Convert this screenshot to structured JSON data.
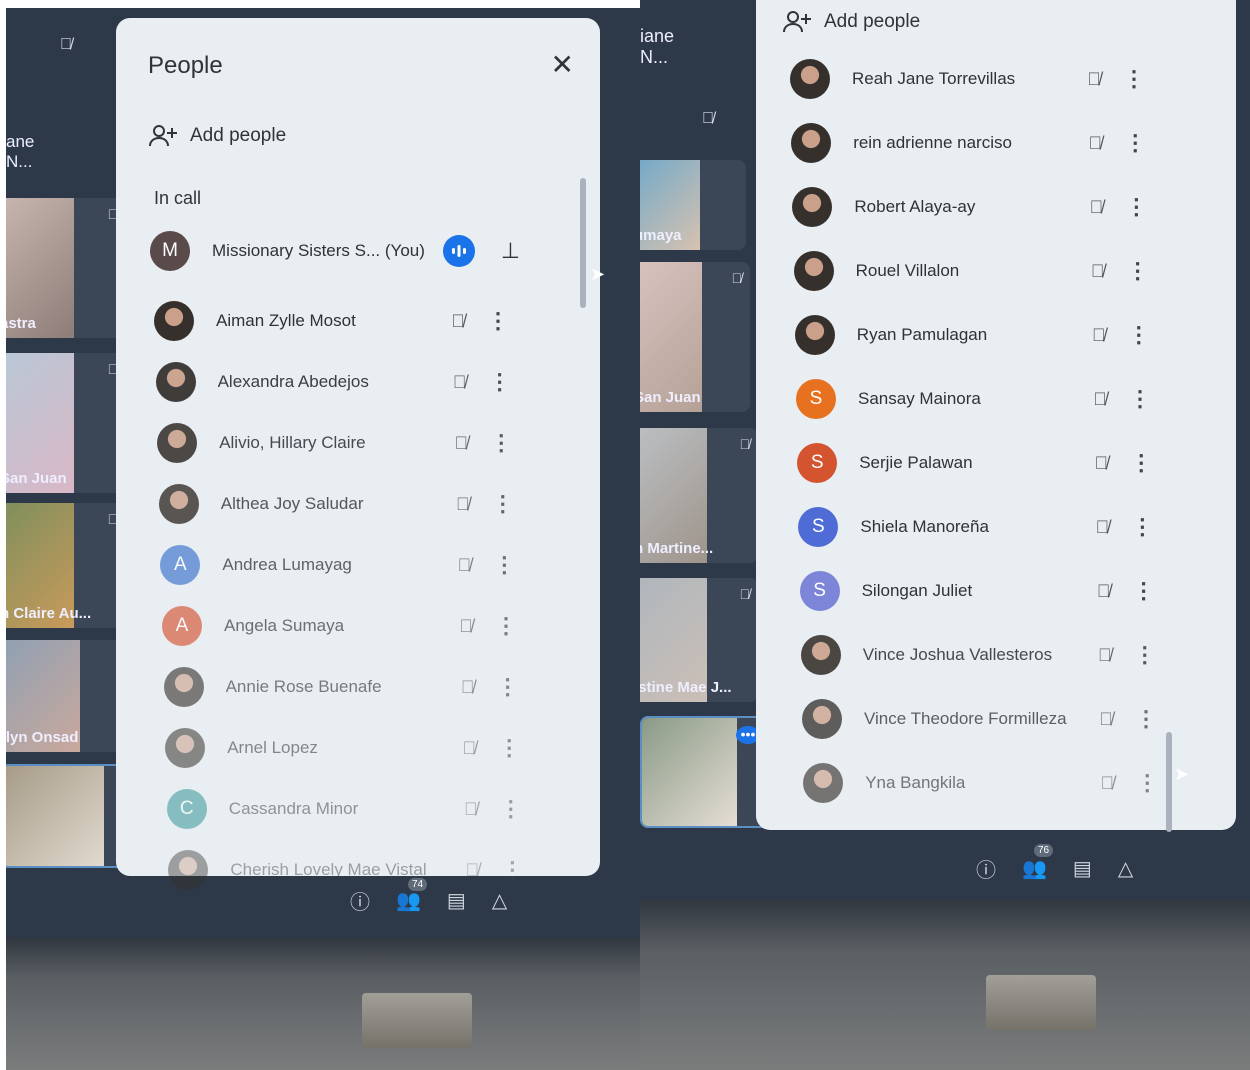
{
  "left": {
    "panel_title": "People",
    "add_people_label": "Add people",
    "section_label": "In call",
    "self": {
      "initial": "M",
      "name": "Missionary Sisters S...",
      "you_tag": "(You)"
    },
    "participants": [
      {
        "name": "Aiman Zylle Mosot",
        "initial": "",
        "color": ""
      },
      {
        "name": "Alexandra Abedejos",
        "initial": "",
        "color": ""
      },
      {
        "name": "Alivio, Hillary Claire",
        "initial": "",
        "color": ""
      },
      {
        "name": "Althea Joy Saludar",
        "initial": "",
        "color": ""
      },
      {
        "name": "Andrea Lumayag",
        "initial": "A",
        "color": "#4f7fd1"
      },
      {
        "name": "Angela Sumaya",
        "initial": "A",
        "color": "#d55a3a"
      },
      {
        "name": "Annie Rose Buenafe",
        "initial": "",
        "color": ""
      },
      {
        "name": "Arnel Lopez",
        "initial": "",
        "color": ""
      },
      {
        "name": "Cassandra Minor",
        "initial": "C",
        "color": "#1b8a8d"
      },
      {
        "name": "Cherish Lovely Mae Vistal",
        "initial": "",
        "color": ""
      }
    ],
    "tiles": [
      "ane N...",
      "astra",
      "San Juan",
      "h Claire Au...",
      "rlyn Onsad",
      ""
    ],
    "people_count": "74"
  },
  "right": {
    "add_people_label": "Add people",
    "participants": [
      {
        "name": "Reah Jane Torrevillas",
        "initial": "",
        "color": ""
      },
      {
        "name": "rein adrienne narciso",
        "initial": "",
        "color": ""
      },
      {
        "name": "Robert Alaya-ay",
        "initial": "",
        "color": ""
      },
      {
        "name": "Rouel Villalon",
        "initial": "",
        "color": ""
      },
      {
        "name": "Ryan Pamulagan",
        "initial": "",
        "color": ""
      },
      {
        "name": "Sansay Mainora",
        "initial": "S",
        "color": "#e8711f"
      },
      {
        "name": "Serjie Palawan",
        "initial": "S",
        "color": "#d4542f"
      },
      {
        "name": "Shiela Manoreña",
        "initial": "S",
        "color": "#4f6bd6"
      },
      {
        "name": "Silongan Juliet",
        "initial": "S",
        "color": "#7d85d8"
      },
      {
        "name": "Vince Joshua Vallesteros",
        "initial": "",
        "color": ""
      },
      {
        "name": "Vince Theodore Formilleza",
        "initial": "",
        "color": ""
      },
      {
        "name": "Yna Bangkila",
        "initial": "",
        "color": ""
      }
    ],
    "tiles": [
      "iane N...",
      "umaya",
      "San Juan",
      "n Martine...",
      "istine Mae J...",
      ""
    ],
    "people_count": "76"
  },
  "icons": {
    "muted": "mic-off-icon",
    "more": "more-vert-icon",
    "pin": "pin-icon",
    "close": "close-icon",
    "add": "person-add-icon"
  }
}
